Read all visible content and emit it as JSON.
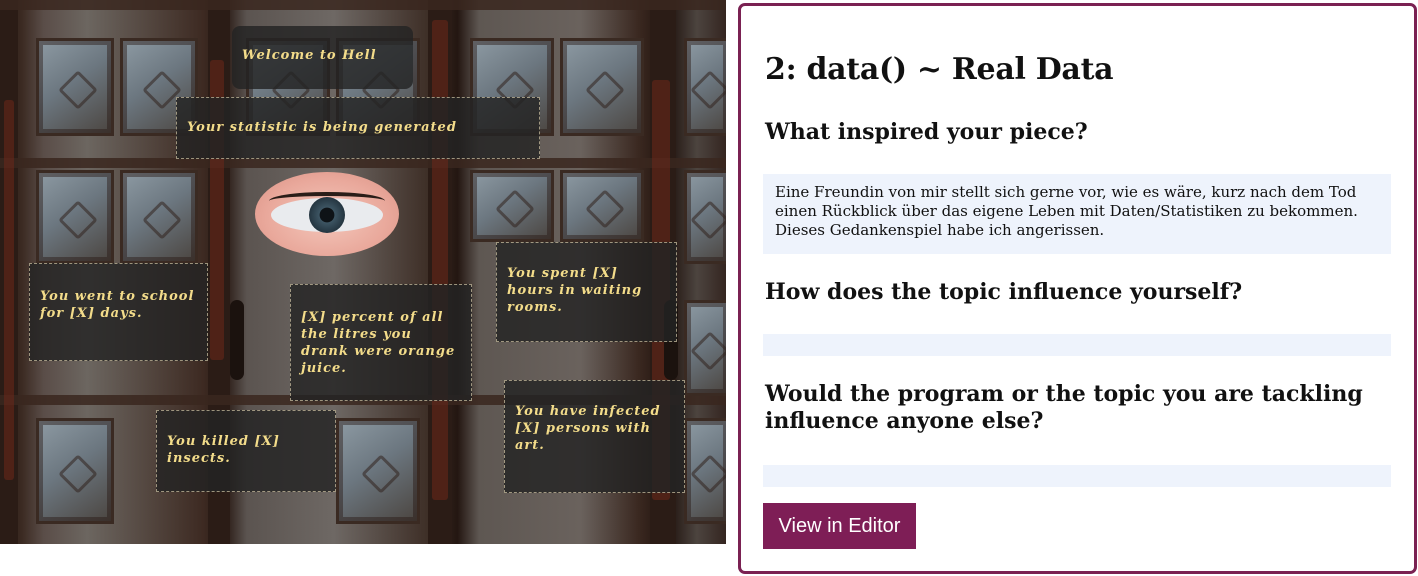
{
  "artwork": {
    "captions": [
      "Welcome to Hell",
      "Your statistic is being generated",
      "You went to school for [X] days.",
      "[X] percent of all the litres you drank were orange juice.",
      "You spent [X] hours in waiting rooms.",
      "You killed [X] insects.",
      "You have infected [X] persons with art."
    ],
    "eye_icon": "eye-icon"
  },
  "card": {
    "title": "2: data() ~ Real Data",
    "questions": [
      {
        "q": "What inspired your piece?",
        "a": "Eine Freundin von mir stellt sich gerne vor, wie es wäre, kurz nach dem Tod einen Rückblick über das eigene Leben mit Daten/Statistiken zu bekommen. Dieses Gedankenspiel habe ich angerissen."
      },
      {
        "q": "How does the topic influence yourself?",
        "a": ""
      },
      {
        "q": "Would the program or the topic you are tackling influence anyone else?",
        "a": ""
      }
    ],
    "button_label": "View in Editor",
    "colors": {
      "accent": "#7e1e56",
      "answer_bg": "#eef3fc"
    }
  }
}
